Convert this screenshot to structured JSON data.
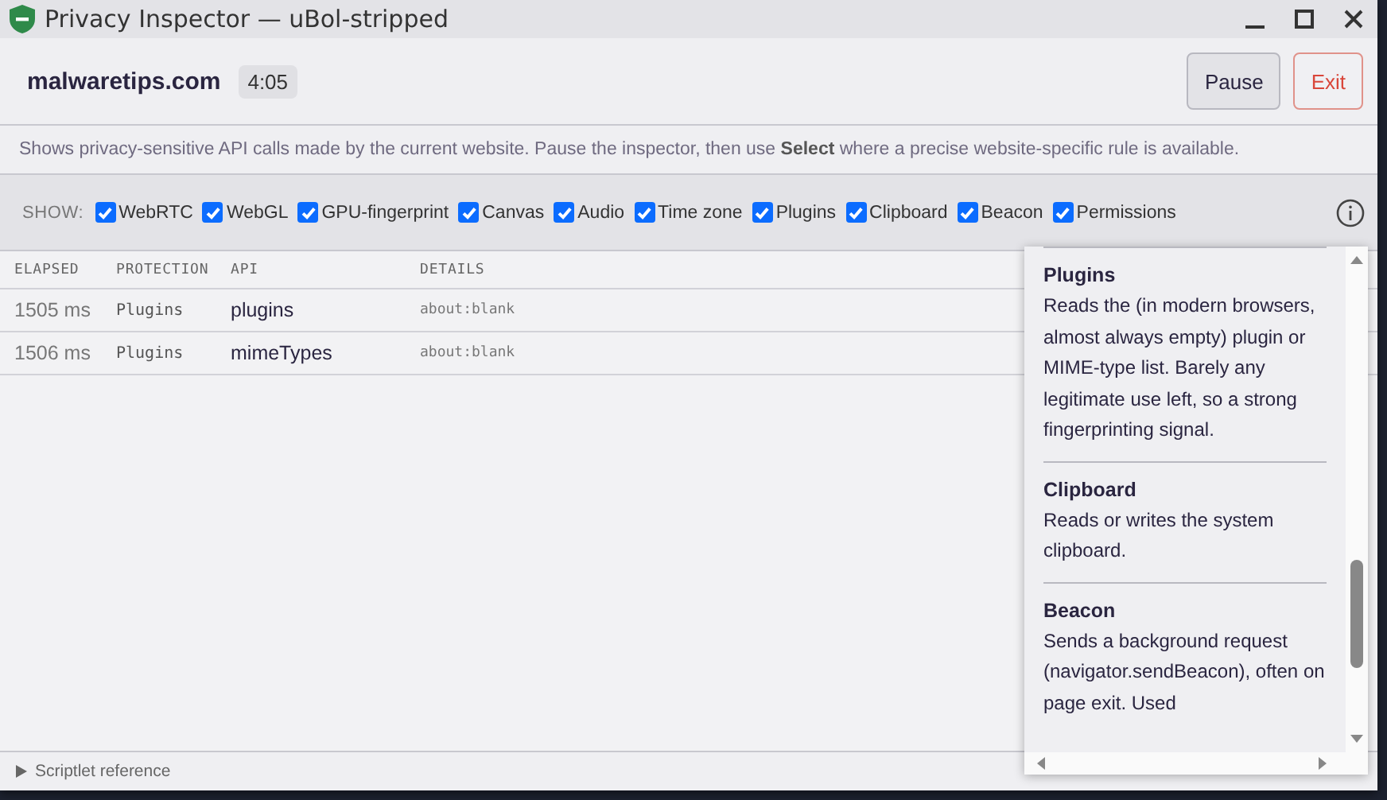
{
  "window": {
    "title": "Privacy Inspector — uBol-stripped"
  },
  "header": {
    "site": "malwaretips.com",
    "timer": "4:05",
    "buttons": [
      {
        "label": "Pause",
        "kind": "normal"
      },
      {
        "label": "Exit",
        "kind": "danger"
      }
    ]
  },
  "description": "Shows privacy-sensitive API calls made by the current website. Pause the inspector, then use **Select** where a precise website-specific rule is available.",
  "filters": {
    "label": "SHOW:",
    "items": [
      {
        "label": "WebRTC",
        "checked": true
      },
      {
        "label": "WebGL",
        "checked": true
      },
      {
        "label": "GPU-fingerprint",
        "checked": true
      },
      {
        "label": "Canvas",
        "checked": true
      },
      {
        "label": "Audio",
        "checked": true
      },
      {
        "label": "Time zone",
        "checked": true
      },
      {
        "label": "Plugins",
        "checked": true
      },
      {
        "label": "Clipboard",
        "checked": true
      },
      {
        "label": "Beacon",
        "checked": true
      },
      {
        "label": "Permissions",
        "checked": true
      }
    ]
  },
  "table": {
    "columns": [
      "ELAPSED",
      "PROTECTION",
      "API",
      "DETAILS"
    ],
    "rows": [
      [
        "1505 ms",
        "Plugins",
        "plugins",
        "about:blank"
      ],
      [
        "1506 ms",
        "Plugins",
        "mimeTypes",
        "about:blank"
      ]
    ]
  },
  "info_popup": {
    "entries": [
      {
        "title": "Plugins",
        "text": "Reads the (in modern browsers, almost always empty) plugin or MIME-type list. Barely any legitimate use left, so a strong fingerprinting signal."
      },
      {
        "title": "Clipboard",
        "text": "Reads or writes the system clipboard."
      },
      {
        "title": "Beacon",
        "text": "Sends a background request (navigator.sendBeacon), often on page exit. Used"
      }
    ]
  },
  "footer": {
    "label": "Scriptlet reference"
  }
}
